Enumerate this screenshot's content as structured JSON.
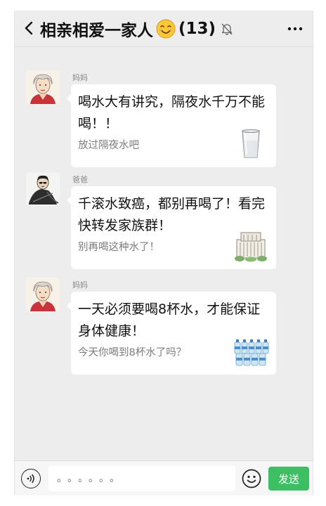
{
  "header": {
    "back_icon": "chevron-left-icon",
    "title": "相亲相爱一家人",
    "title_emoji": "smiling-face-icon",
    "member_count": "(13)",
    "mute_icon": "bell-off-icon",
    "more_icon": "more-dots-icon"
  },
  "messages": [
    {
      "sender": "妈妈",
      "text": "喝水大有讲究，隔夜水千万不能喝！！",
      "subtext": "放过隔夜水吧",
      "thumbnail": "water-glass-icon"
    },
    {
      "sender": "爸爸",
      "text": "千滚水致癌，都别再喝了！看完快转发家族群！",
      "subtext": "别再喝这种水了！",
      "thumbnail": "building-icon"
    },
    {
      "sender": "妈妈",
      "text": "一天必须要喝8杯水，才能保证身体健康！",
      "subtext": "今天你喝到8杯水了吗？",
      "thumbnail": "water-bottles-icon"
    }
  ],
  "bottom_bar": {
    "voice_icon": "voice-icon",
    "input_placeholder": "。。。。。。",
    "emoji_icon": "emoji-icon",
    "send_label": "发送"
  },
  "colors": {
    "chat_background": "#ededed",
    "bubble": "#ffffff",
    "send_button": "#3cbf63"
  }
}
